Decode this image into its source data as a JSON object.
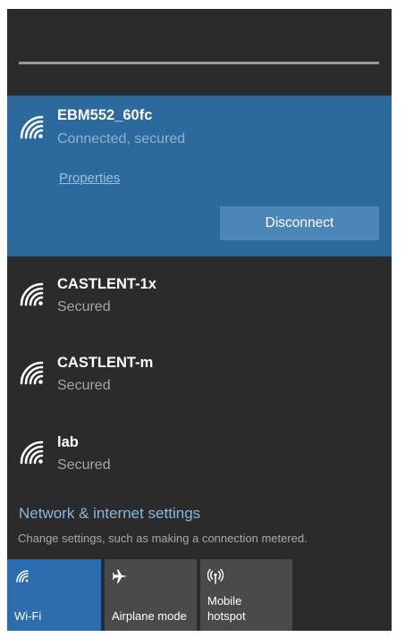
{
  "networks": [
    {
      "name": "EBM552_60fc",
      "status": "Connected, secured"
    },
    {
      "name": "CASTLENT-1x",
      "status": "Secured"
    },
    {
      "name": "CASTLENT-m",
      "status": "Secured"
    },
    {
      "name": "lab",
      "status": "Secured"
    }
  ],
  "connected": {
    "properties_label": "Properties",
    "disconnect_label": "Disconnect"
  },
  "settings": {
    "title": "Network & internet settings",
    "subtitle": "Change settings, such as making a connection metered."
  },
  "quick_actions": [
    {
      "label": "Wi-Fi",
      "icon": "wifi-icon",
      "active": true
    },
    {
      "label": "Airplane mode",
      "icon": "airplane-icon",
      "active": false
    },
    {
      "label": "Mobile hotspot",
      "icon": "mobile-hotspot-icon",
      "active": false
    }
  ],
  "colors": {
    "panel_bg": "#2b2b2b",
    "accent": "#2c6a9d",
    "link": "#8ab6de",
    "tile_active": "#2c6ead",
    "tile_inactive": "#4a4a4a"
  }
}
